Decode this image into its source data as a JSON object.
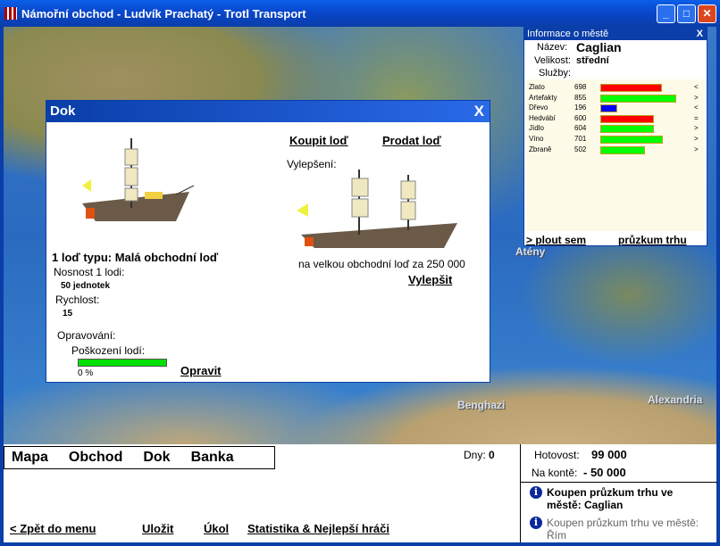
{
  "window": {
    "title": "Námořní obchod - Ludvík Prachatý - Trotl Transport"
  },
  "map": {
    "labels": [
      "Atény",
      "Benghazi",
      "Alexandria"
    ]
  },
  "dok": {
    "title": "Dok",
    "close": "X",
    "buy": "Koupit loď",
    "sell": "Prodat loď",
    "upgrades_label": "Vylepšení:",
    "ship_count": "1 loď typu: Malá obchodní loď",
    "capacity_label": "Nosnost 1 lodi:",
    "capacity": "50 jednotek",
    "speed_label": "Rychlost:",
    "speed": "15",
    "repair_label": "Opravování:",
    "damage_label": "Poškození lodí:",
    "damage": "0 %",
    "damage_fraction": 0,
    "repair": "Opravit",
    "upgrade_text": "na velkou obchodní loď za 250 000",
    "upgrade": "Vylepšit"
  },
  "info": {
    "title": "Informace o městě",
    "close": "X",
    "name_label": "Název:",
    "name": "Caglian",
    "size_label": "Velikost:",
    "size": "střední",
    "services_label": "Služby:",
    "goods": [
      {
        "name": "Zlato",
        "price": "698",
        "trend": "<",
        "color": "#ff0000"
      },
      {
        "name": "Artefakty",
        "price": "855",
        "trend": ">",
        "color": "#00ff00"
      },
      {
        "name": "Dřevo",
        "price": "196",
        "trend": "<",
        "color": "#0000ff"
      },
      {
        "name": "Hedvábí",
        "price": "600",
        "trend": "=",
        "color": "#ff0000"
      },
      {
        "name": "Jídlo",
        "price": "604",
        "trend": ">",
        "color": "#00ff00"
      },
      {
        "name": "Víno",
        "price": "701",
        "trend": ">",
        "color": "#00ff00"
      },
      {
        "name": "Zbraně",
        "price": "502",
        "trend": ">",
        "color": "#00ff00"
      }
    ],
    "sail": "> plout sem",
    "survey": "průzkum trhu"
  },
  "nav": [
    "Mapa",
    "Obchod",
    "Dok",
    "Banka"
  ],
  "days_label": "Dny:",
  "days": "0",
  "cash_label": "Hotovost:",
  "cash": "99 000",
  "account_label": "Na kontě:",
  "account": "- 50 000",
  "messages": [
    "Koupen průzkum trhu ve městě: Caglian",
    "Koupen průzkum trhu ve městě: Řím"
  ],
  "footer": [
    "< Zpět do menu",
    "Uložit",
    "Úkol",
    "Statistika & Nejlepší hráči"
  ]
}
